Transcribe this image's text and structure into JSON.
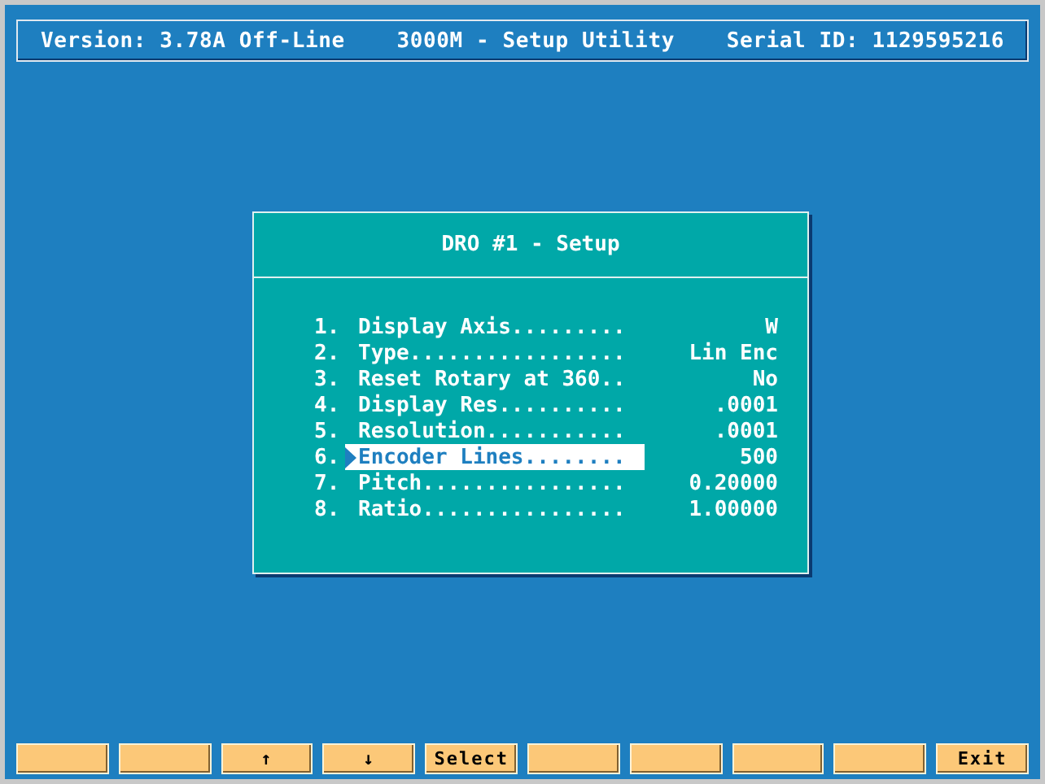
{
  "header": {
    "version": "Version: 3.78A Off-Line",
    "title": "3000M - Setup Utility",
    "serial": "Serial ID: 1129595216"
  },
  "dialog": {
    "title": "DRO #1 - Setup",
    "items": [
      {
        "number": "1.",
        "label": "Display Axis.........",
        "value": "W",
        "selected": false
      },
      {
        "number": "2.",
        "label": "Type.................",
        "value": "Lin Enc",
        "selected": false
      },
      {
        "number": "3.",
        "label": "Reset Rotary at 360..",
        "value": "No",
        "selected": false
      },
      {
        "number": "4.",
        "label": "Display Res..........",
        "value": ".0001",
        "selected": false
      },
      {
        "number": "5.",
        "label": "Resolution...........",
        "value": ".0001",
        "selected": false
      },
      {
        "number": "6.",
        "label": "Encoder Lines........",
        "value": "500",
        "selected": true
      },
      {
        "number": "7.",
        "label": "Pitch................",
        "value": "0.20000",
        "selected": false
      },
      {
        "number": "8.",
        "label": "Ratio................",
        "value": "1.00000",
        "selected": false
      }
    ]
  },
  "function_keys": [
    {
      "kind": "blank"
    },
    {
      "kind": "blank"
    },
    {
      "kind": "labeled",
      "label": "↑"
    },
    {
      "kind": "labeled",
      "label": "↓"
    },
    {
      "kind": "labeled",
      "label": "Select"
    },
    {
      "kind": "blank"
    },
    {
      "kind": "blank"
    },
    {
      "kind": "blank"
    },
    {
      "kind": "blank"
    },
    {
      "kind": "labeled",
      "label": "Exit"
    }
  ]
}
